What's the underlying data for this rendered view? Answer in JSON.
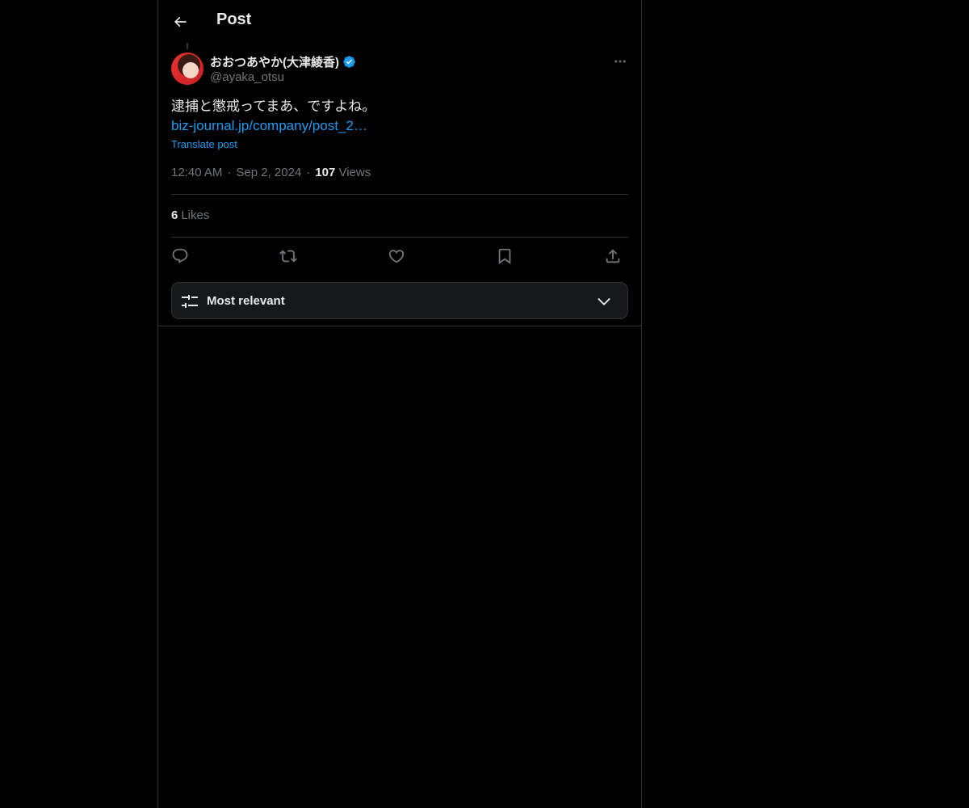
{
  "header": {
    "title": "Post",
    "back_icon": "arrow-left-icon"
  },
  "post": {
    "author": {
      "name": "おおつあやか(大津綾香)",
      "handle": "@ayaka_otsu",
      "verified": true
    },
    "text": "逮捕と懲戒ってまあ、ですよね。",
    "link": "biz-journal.jp/company/post_2…",
    "translate_label": "Translate post",
    "time": "12:40 AM",
    "separator": "·",
    "date": "Sep 2, 2024",
    "views_count": "107",
    "views_label": "Views",
    "likes_count": "6",
    "likes_label": "Likes"
  },
  "actions": [
    "reply-icon",
    "repost-icon",
    "like-icon",
    "bookmark-icon",
    "share-icon"
  ],
  "sort": {
    "label": "Most relevant",
    "icon": "sliders-icon",
    "chevron": "chevron-down-icon"
  },
  "colors": {
    "background": "#000000",
    "border": "#2f3336",
    "accent": "#1d9bf0",
    "text_primary": "#e7e9ea",
    "text_secondary": "#71767b"
  }
}
